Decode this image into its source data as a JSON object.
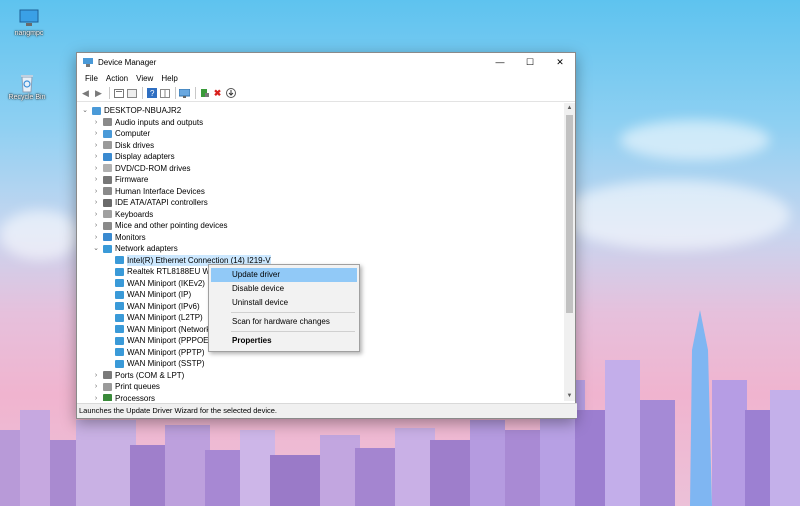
{
  "desktop": {
    "icons": [
      {
        "label": "nangmpc",
        "icon": "computer-icon"
      },
      {
        "label": "Recycle Bin",
        "icon": "recycle-bin-icon"
      }
    ]
  },
  "window": {
    "title": "Device Manager",
    "controls": {
      "minimize": "—",
      "maximize": "☐",
      "close": "✕"
    },
    "menu": [
      "File",
      "Action",
      "View",
      "Help"
    ],
    "toolbar": [
      "back-icon",
      "forward-icon",
      "properties-icon",
      "show-hidden-icon",
      "help-icon",
      "monitor-icon",
      "update-driver-icon",
      "uninstall-icon",
      "download-icon"
    ],
    "tree": {
      "root": "DESKTOP-NBUAJR2",
      "categories": [
        "Audio inputs and outputs",
        "Computer",
        "Disk drives",
        "Display adapters",
        "DVD/CD-ROM drives",
        "Firmware",
        "Human Interface Devices",
        "IDE ATA/ATAPI controllers",
        "Keyboards",
        "Mice and other pointing devices",
        "Monitors",
        "Network adapters"
      ],
      "network_adapters": [
        "Intel(R) Ethernet Connection (14) I219-V",
        "Realtek RTL8188EU Wire",
        "WAN Miniport (IKEv2)",
        "WAN Miniport (IP)",
        "WAN Miniport (IPv6)",
        "WAN Miniport (L2TP)",
        "WAN Miniport (Network",
        "WAN Miniport (PPPOE)",
        "WAN Miniport (PPTP)",
        "WAN Miniport (SSTP)"
      ],
      "after": [
        "Ports (COM & LPT)",
        "Print queues",
        "Processors"
      ]
    },
    "status": "Launches the Update Driver Wizard for the selected device."
  },
  "context_menu": {
    "items": [
      "Update driver",
      "Disable device",
      "Uninstall device",
      "Scan for hardware changes",
      "Properties"
    ]
  },
  "colors": {
    "selection": "#cce8ff",
    "menu_highlight": "#91c9f7",
    "accent": "#0078d7"
  }
}
